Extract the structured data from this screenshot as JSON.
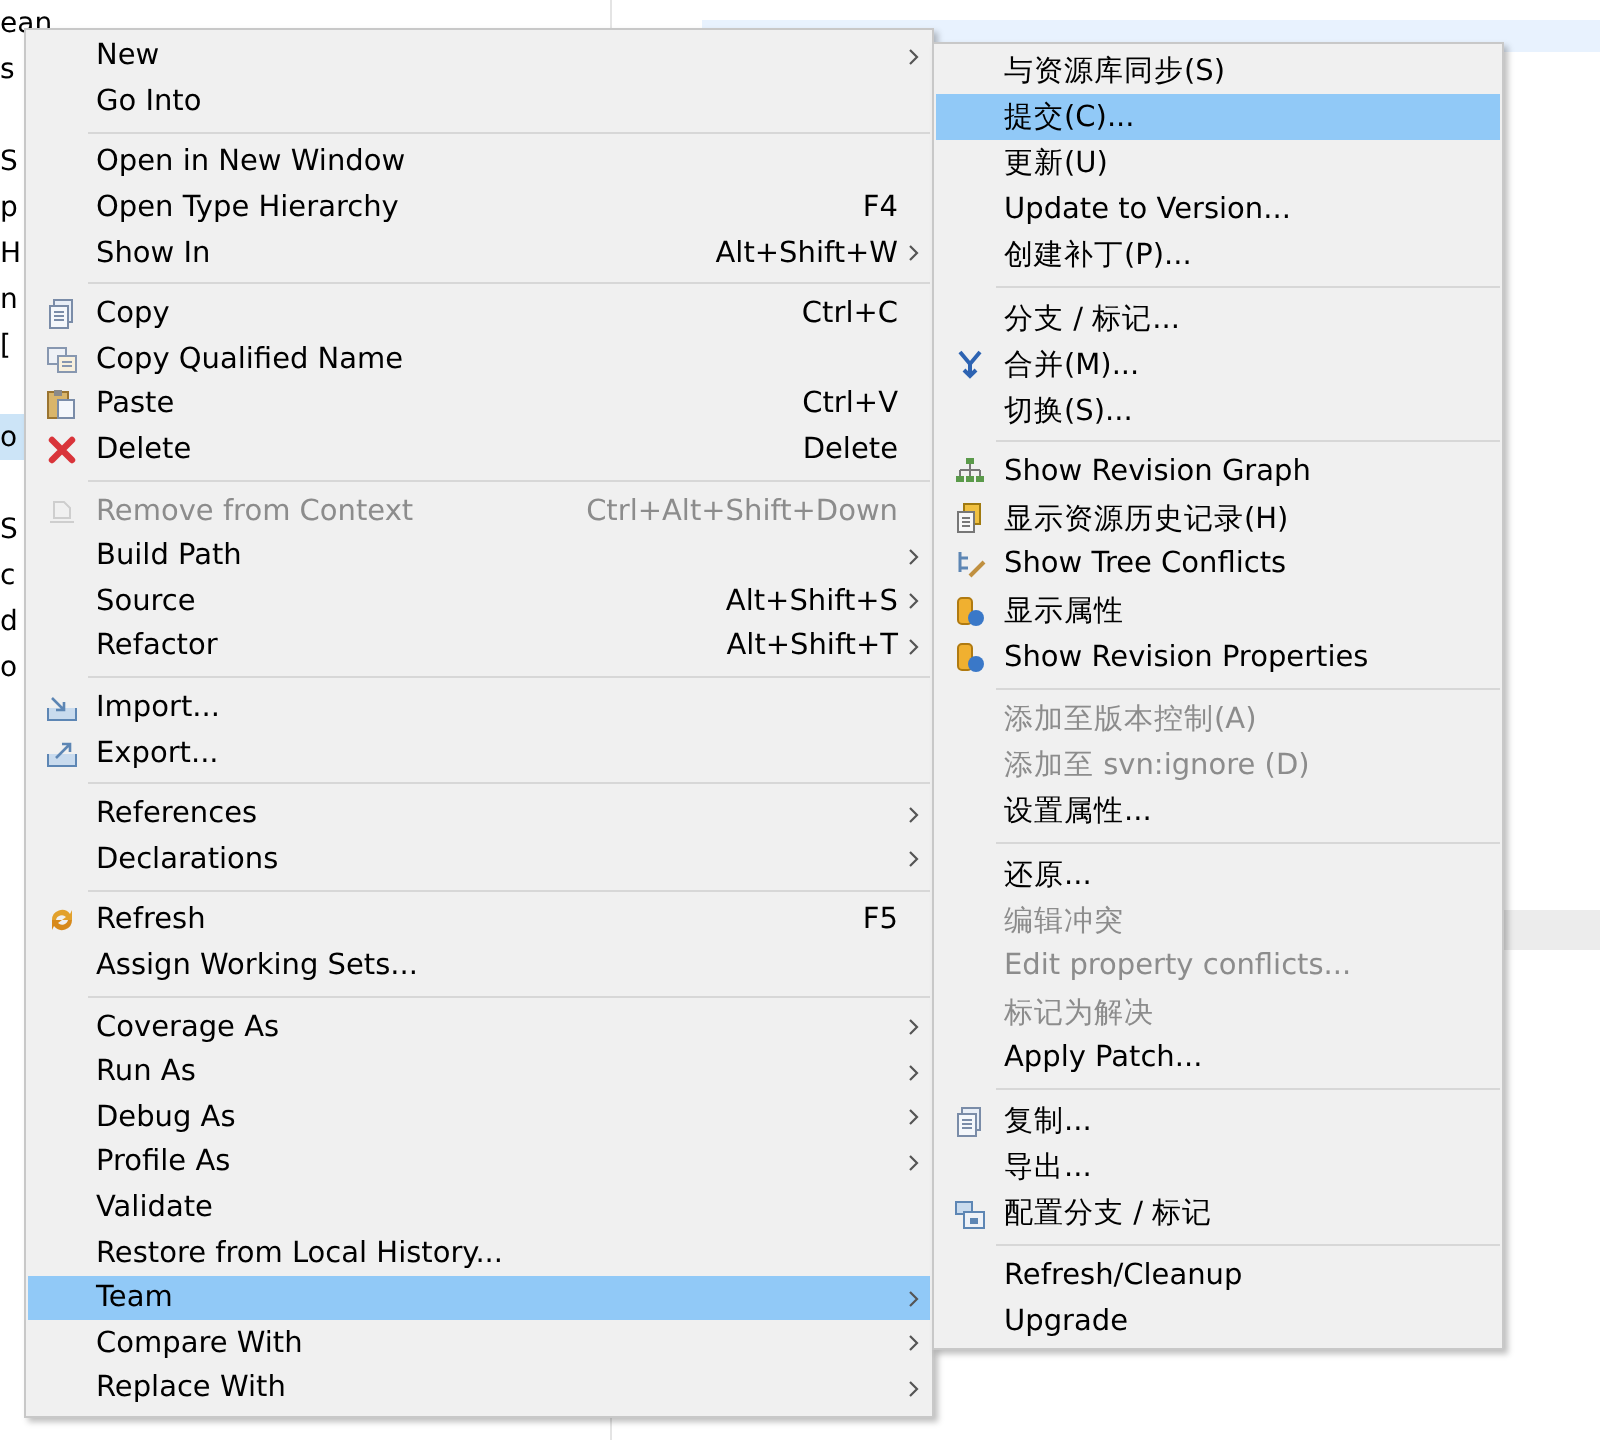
{
  "tree_fragments": [
    {
      "kind": "node",
      "label": "ean",
      "selected": false
    },
    {
      "kind": "node",
      "label": "s",
      "selected": false
    },
    {
      "kind": "gap"
    },
    {
      "kind": "node",
      "label": "S",
      "selected": false
    },
    {
      "kind": "node",
      "label": "p",
      "selected": false
    },
    {
      "kind": "node",
      "label": "H",
      "selected": false
    },
    {
      "kind": "node",
      "label": "n",
      "selected": false
    },
    {
      "kind": "node",
      "label": "[",
      "selected": false
    },
    {
      "kind": "gap"
    },
    {
      "kind": "node",
      "label": "o",
      "selected": true
    },
    {
      "kind": "gap"
    },
    {
      "kind": "node",
      "label": "S",
      "selected": false
    },
    {
      "kind": "node",
      "label": "c",
      "selected": false
    },
    {
      "kind": "node",
      "label": "d",
      "selected": false
    },
    {
      "kind": "node",
      "label": "o",
      "selected": false
    }
  ],
  "context_menu": {
    "items": [
      {
        "kind": "item",
        "label": "New",
        "submenu": true,
        "disabled": false,
        "selected": false
      },
      {
        "kind": "item",
        "label": "Go Into",
        "submenu": false,
        "disabled": false,
        "selected": false
      },
      {
        "kind": "separator"
      },
      {
        "kind": "item",
        "label": "Open in New Window",
        "submenu": false,
        "disabled": false,
        "selected": false
      },
      {
        "kind": "item",
        "label": "Open Type Hierarchy",
        "shortcut": "F4",
        "submenu": false,
        "disabled": false,
        "selected": false
      },
      {
        "kind": "item",
        "label": "Show In",
        "shortcut": "Alt+Shift+W",
        "submenu": true,
        "disabled": false,
        "selected": false
      },
      {
        "kind": "separator"
      },
      {
        "kind": "item",
        "label": "Copy",
        "shortcut": "Ctrl+C",
        "submenu": false,
        "disabled": false,
        "selected": false
      },
      {
        "kind": "item",
        "label": "Copy Qualified Name",
        "submenu": false,
        "disabled": false,
        "selected": false
      },
      {
        "kind": "item",
        "label": "Paste",
        "shortcut": "Ctrl+V",
        "submenu": false,
        "disabled": false,
        "selected": false
      },
      {
        "kind": "item",
        "label": "Delete",
        "shortcut": "Delete",
        "submenu": false,
        "disabled": false,
        "selected": false
      },
      {
        "kind": "separator"
      },
      {
        "kind": "item",
        "label": "Remove from Context",
        "shortcut": "Ctrl+Alt+Shift+Down",
        "submenu": false,
        "disabled": true,
        "selected": false
      },
      {
        "kind": "item",
        "label": "Build Path",
        "submenu": true,
        "disabled": false,
        "selected": false
      },
      {
        "kind": "item",
        "label": "Source",
        "shortcut": "Alt+Shift+S",
        "submenu": true,
        "disabled": false,
        "selected": false
      },
      {
        "kind": "item",
        "label": "Refactor",
        "shortcut": "Alt+Shift+T",
        "submenu": true,
        "disabled": false,
        "selected": false
      },
      {
        "kind": "separator"
      },
      {
        "kind": "item",
        "label": "Import...",
        "submenu": false,
        "disabled": false,
        "selected": false
      },
      {
        "kind": "item",
        "label": "Export...",
        "submenu": false,
        "disabled": false,
        "selected": false
      },
      {
        "kind": "separator"
      },
      {
        "kind": "item",
        "label": "References",
        "submenu": true,
        "disabled": false,
        "selected": false
      },
      {
        "kind": "item",
        "label": "Declarations",
        "submenu": true,
        "disabled": false,
        "selected": false
      },
      {
        "kind": "separator"
      },
      {
        "kind": "item",
        "label": "Refresh",
        "shortcut": "F5",
        "submenu": false,
        "disabled": false,
        "selected": false
      },
      {
        "kind": "item",
        "label": "Assign Working Sets...",
        "submenu": false,
        "disabled": false,
        "selected": false
      },
      {
        "kind": "separator"
      },
      {
        "kind": "item",
        "label": "Coverage As",
        "submenu": true,
        "disabled": false,
        "selected": false
      },
      {
        "kind": "item",
        "label": "Run As",
        "submenu": true,
        "disabled": false,
        "selected": false
      },
      {
        "kind": "item",
        "label": "Debug As",
        "submenu": true,
        "disabled": false,
        "selected": false
      },
      {
        "kind": "item",
        "label": "Profile As",
        "submenu": true,
        "disabled": false,
        "selected": false
      },
      {
        "kind": "item",
        "label": "Validate",
        "submenu": false,
        "disabled": false,
        "selected": false
      },
      {
        "kind": "item",
        "label": "Restore from Local History...",
        "submenu": false,
        "disabled": false,
        "selected": false
      },
      {
        "kind": "item",
        "label": "Team",
        "submenu": true,
        "disabled": false,
        "selected": true
      },
      {
        "kind": "item",
        "label": "Compare With",
        "submenu": true,
        "disabled": false,
        "selected": false
      },
      {
        "kind": "item",
        "label": "Replace With",
        "submenu": true,
        "disabled": false,
        "selected": false
      }
    ]
  },
  "team_submenu": {
    "items": [
      {
        "kind": "item",
        "label": "与资源库同步(S)",
        "disabled": false,
        "selected": false
      },
      {
        "kind": "item",
        "label": "提交(C)...",
        "disabled": false,
        "selected": true
      },
      {
        "kind": "item",
        "label": "更新(U)",
        "disabled": false,
        "selected": false
      },
      {
        "kind": "item",
        "label": "Update to Version...",
        "disabled": false,
        "selected": false
      },
      {
        "kind": "item",
        "label": "创建补丁(P)...",
        "disabled": false,
        "selected": false
      },
      {
        "kind": "separator"
      },
      {
        "kind": "item",
        "label": "分支 / 标记...",
        "disabled": false,
        "selected": false
      },
      {
        "kind": "item",
        "label": "合并(M)...",
        "disabled": false,
        "selected": false
      },
      {
        "kind": "item",
        "label": "切换(S)...",
        "disabled": false,
        "selected": false
      },
      {
        "kind": "separator"
      },
      {
        "kind": "item",
        "label": "Show Revision Graph",
        "disabled": false,
        "selected": false
      },
      {
        "kind": "item",
        "label": "显示资源历史记录(H)",
        "disabled": false,
        "selected": false
      },
      {
        "kind": "item",
        "label": "Show Tree Conflicts",
        "disabled": false,
        "selected": false
      },
      {
        "kind": "item",
        "label": "显示属性",
        "disabled": false,
        "selected": false
      },
      {
        "kind": "item",
        "label": "Show Revision Properties",
        "disabled": false,
        "selected": false
      },
      {
        "kind": "separator"
      },
      {
        "kind": "item",
        "label": "添加至版本控制(A)",
        "disabled": true,
        "selected": false
      },
      {
        "kind": "item",
        "label": "添加至 svn:ignore (D)",
        "disabled": true,
        "selected": false
      },
      {
        "kind": "item",
        "label": "设置属性...",
        "disabled": false,
        "selected": false
      },
      {
        "kind": "separator"
      },
      {
        "kind": "item",
        "label": "还原...",
        "disabled": false,
        "selected": false
      },
      {
        "kind": "item",
        "label": "编辑冲突",
        "disabled": true,
        "selected": false
      },
      {
        "kind": "item",
        "label": "Edit property conflicts...",
        "disabled": true,
        "selected": false
      },
      {
        "kind": "item",
        "label": "标记为解决",
        "disabled": true,
        "selected": false
      },
      {
        "kind": "item",
        "label": "Apply Patch...",
        "disabled": false,
        "selected": false
      },
      {
        "kind": "separator"
      },
      {
        "kind": "item",
        "label": "复制...",
        "disabled": false,
        "selected": false
      },
      {
        "kind": "item",
        "label": "导出...",
        "disabled": false,
        "selected": false
      },
      {
        "kind": "item",
        "label": "配置分支 / 标记",
        "disabled": false,
        "selected": false
      },
      {
        "kind": "separator"
      },
      {
        "kind": "item",
        "label": "Refresh/Cleanup",
        "disabled": false,
        "selected": false
      },
      {
        "kind": "item",
        "label": "Upgrade",
        "disabled": false,
        "selected": false
      }
    ]
  }
}
